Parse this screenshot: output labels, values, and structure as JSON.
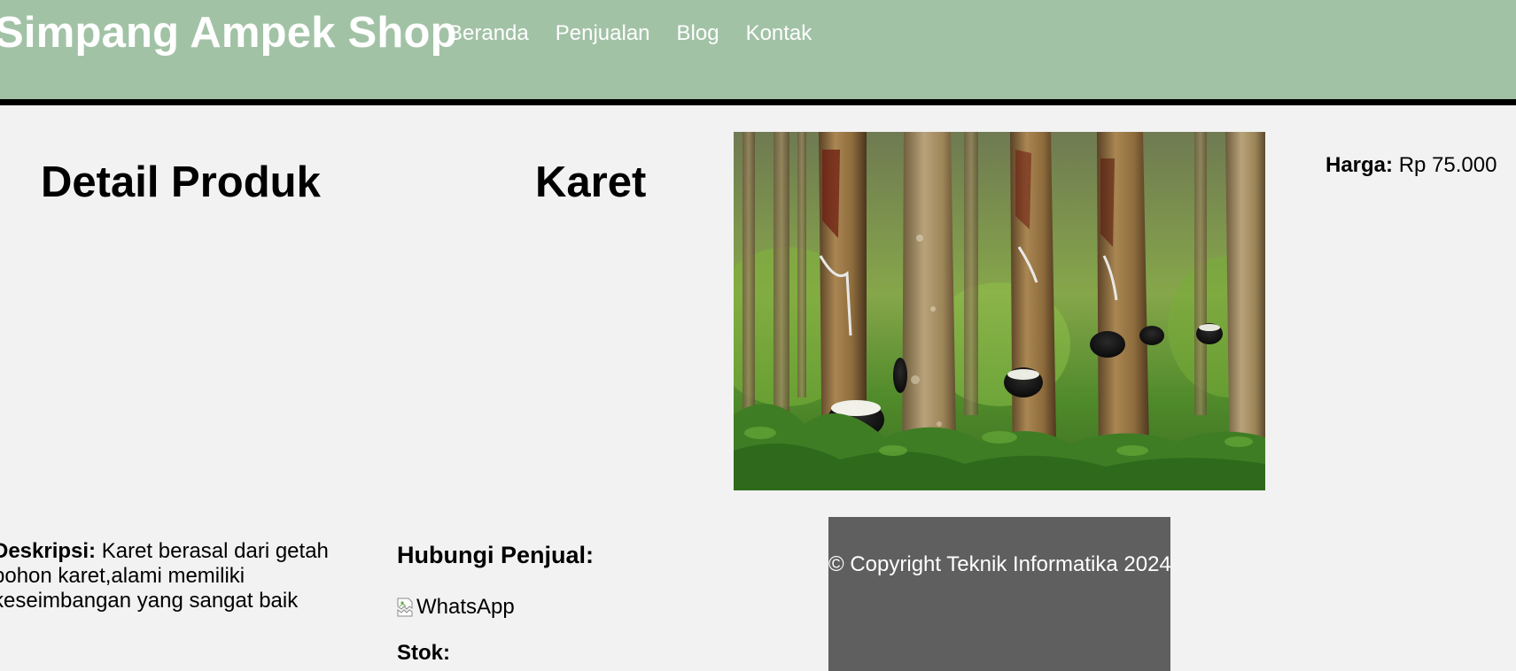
{
  "header": {
    "brand": "Simpang Ampek Shop",
    "nav": [
      {
        "label": "Beranda"
      },
      {
        "label": "Penjualan"
      },
      {
        "label": "Blog"
      },
      {
        "label": "Kontak"
      }
    ],
    "background": "#a2c2a6"
  },
  "main": {
    "heading": "Detail Produk",
    "product_name": "Karet",
    "price_label": "Harga:",
    "price_value": " Rp 75.000",
    "description_label": "Deskripsi:",
    "description_text": " Karet berasal dari getah pohon karet,alami memiliki keseimbangan yang sangat baik",
    "contact_title": "Hubungi Penjual:",
    "whatsapp_alt": "WhatsApp",
    "stock_label": "Stok:"
  },
  "footer": {
    "text": "© Copyright Teknik Informatika 2024",
    "background": "#5f5f5f"
  }
}
